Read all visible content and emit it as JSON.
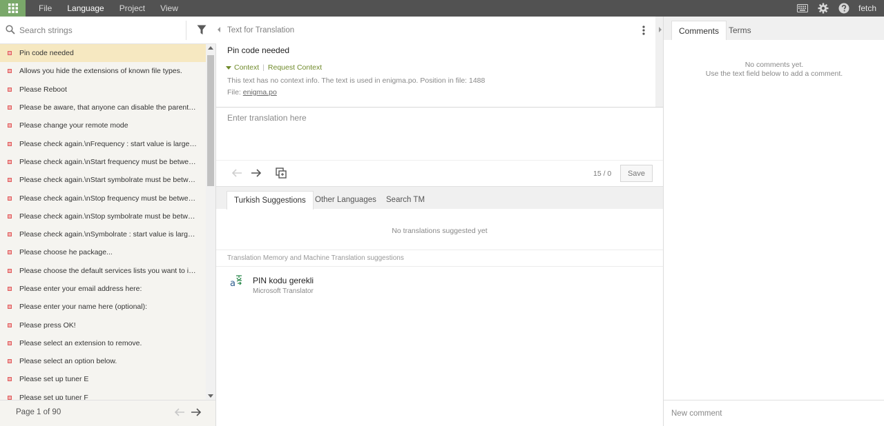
{
  "topbar": {
    "menu": [
      {
        "label": "File",
        "active": false
      },
      {
        "label": "Language",
        "active": true
      },
      {
        "label": "Project",
        "active": false
      },
      {
        "label": "View",
        "active": false
      }
    ],
    "user": "fetch",
    "icons": [
      "keyboard-icon",
      "gear-icon",
      "help-icon"
    ],
    "accent_color": "#7aa86a",
    "bar_color": "#525252"
  },
  "left": {
    "search_placeholder": "Search strings",
    "items": [
      "Pin code needed",
      "Allows you hide the extensions of known file types.",
      "Please Reboot",
      "Please be aware, that anyone can disable the parental control...",
      "Please change your remote mode",
      "Please check again.\\nFrequency : start value is larger than...",
      "Please check again.\\nStart frequency must be between ...",
      "Please check again.\\nStart symbolrate must be between...",
      "Please check again.\\nStop frequency must be between ...",
      "Please check again.\\nStop symbolrate must be between...",
      "Please check again.\\nSymbolrate : start value is larger than...",
      "Please choose he package...",
      "Please choose the default services lists you want to install...",
      "Please enter your email address here:",
      "Please enter your name here (optional):",
      "Please press OK!",
      "Please select an extension to remove.",
      "Please select an option below.",
      "Please set up tuner E",
      "Please set up tuner F"
    ],
    "selected_index": 0,
    "status_color": "#e05a5a",
    "pager": {
      "text": "Page 1 of 90"
    }
  },
  "editor": {
    "header": "Text for Translation",
    "source_text": "Pin code needed",
    "context_label": "Context",
    "request_context_label": "Request Context",
    "context_info": "This text has no context info. The text is used in enigma.po. Position in file: 1488",
    "file_label": "File:",
    "file_name": "enigma.po",
    "translation_placeholder": "Enter translation here",
    "char_count": "15 / 0",
    "save_label": "Save",
    "tabs": [
      "Turkish Suggestions",
      "Other Languages",
      "Search TM"
    ],
    "active_tab": 0,
    "no_suggestions": "No translations suggested yet",
    "tm_header": "Translation Memory and Machine Translation suggestions",
    "tm_items": [
      {
        "text": "PIN kodu gerekli",
        "source": "Microsoft Translator",
        "icon": "translate-icon"
      }
    ]
  },
  "right": {
    "tabs": [
      "Comments",
      "Terms"
    ],
    "active_tab": 0,
    "empty_line1": "No comments yet.",
    "empty_line2": "Use the text field below to add a comment.",
    "comment_placeholder": "New comment"
  }
}
